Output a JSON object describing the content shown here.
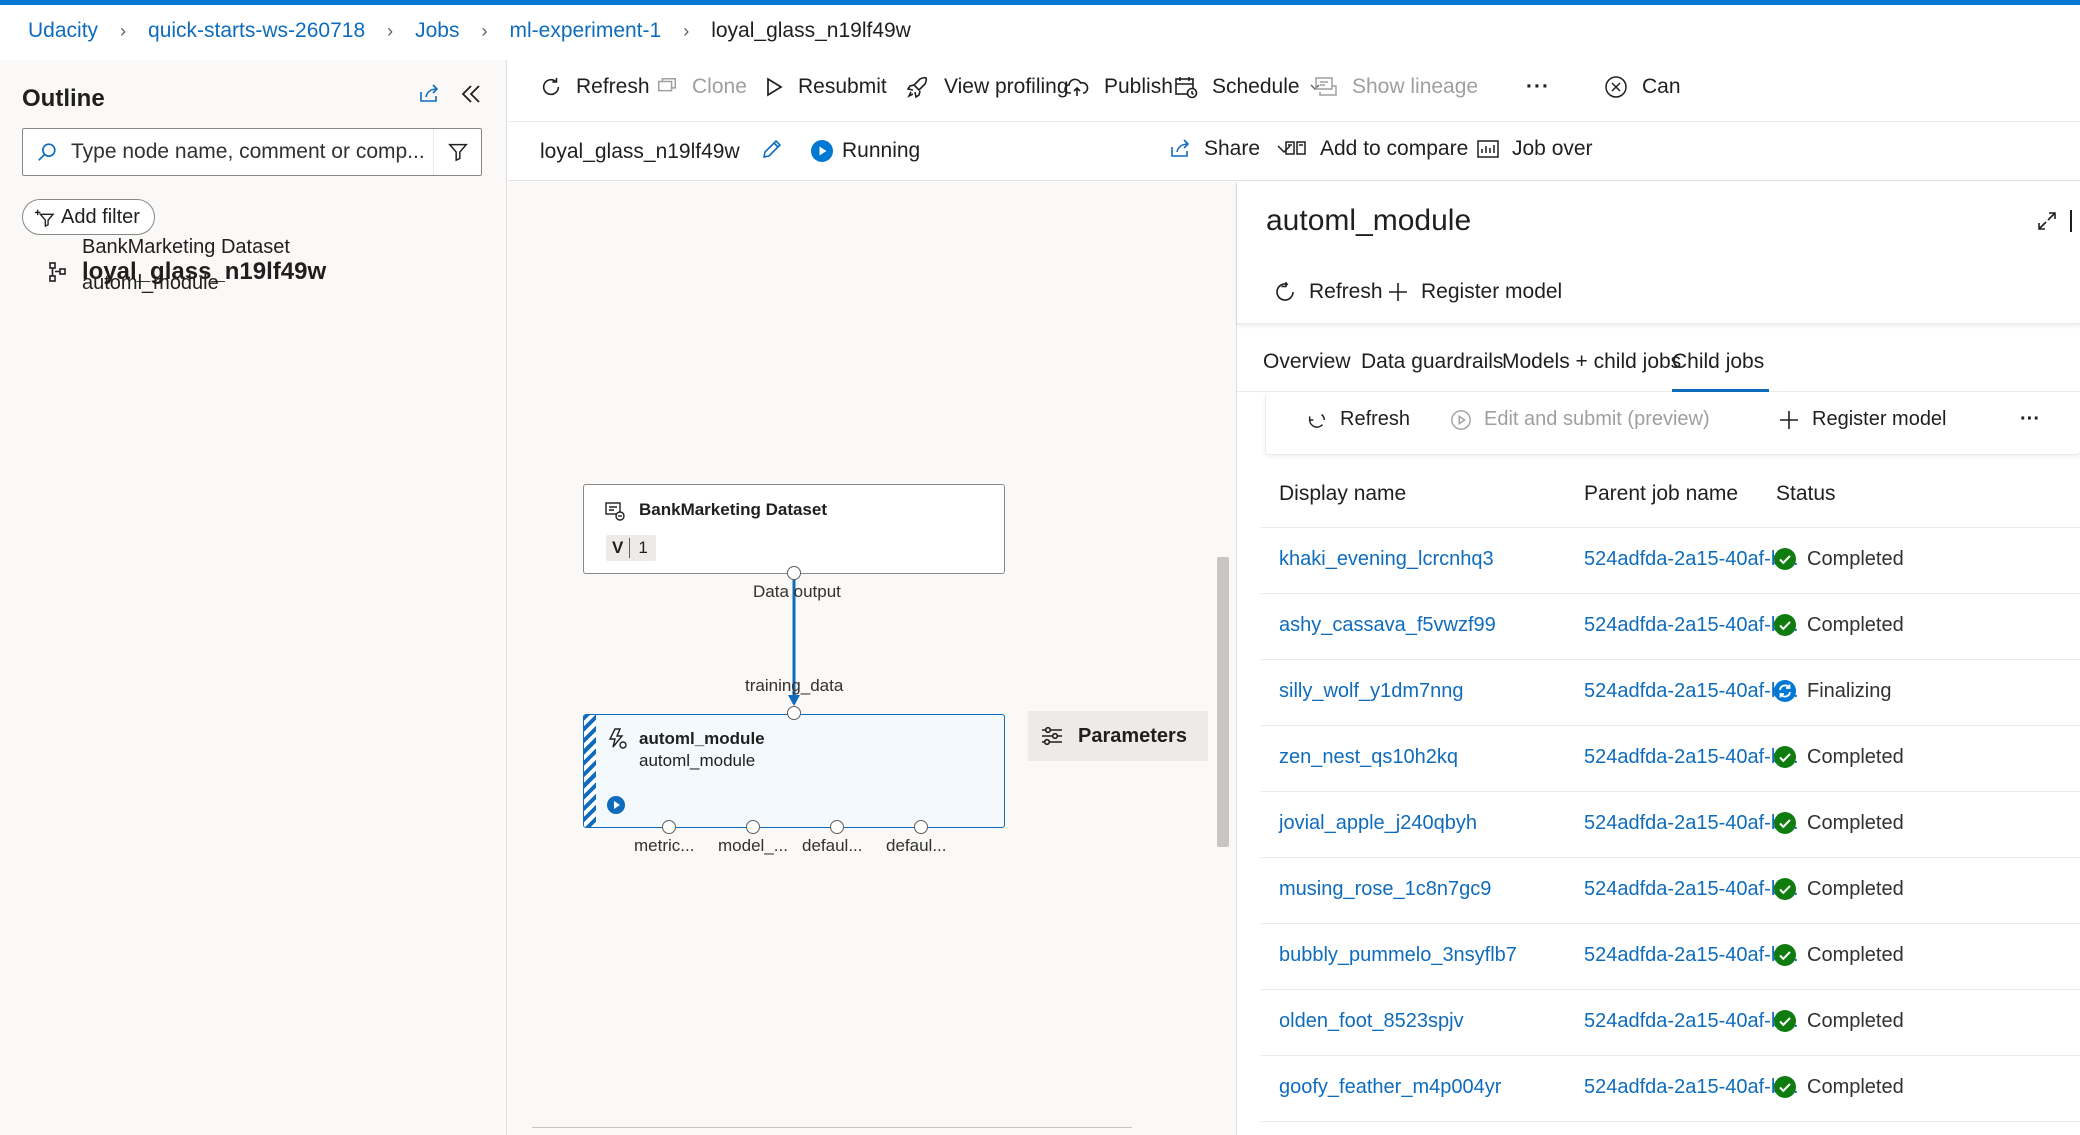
{
  "breadcrumb": {
    "items": [
      "Udacity",
      "quick-starts-ws-260718",
      "Jobs",
      "ml-experiment-1"
    ],
    "current": "loyal_glass_n19lf49w"
  },
  "outline": {
    "title": "Outline",
    "search_placeholder": "Type node name, comment or comp...",
    "add_filter": "Add filter",
    "root": "loyal_glass_n19lf49w",
    "items": [
      "BankMarketing Dataset",
      "automl_module"
    ]
  },
  "toolbar": {
    "refresh": "Refresh",
    "clone": "Clone",
    "resubmit": "Resubmit",
    "view_profiling": "View profiling",
    "publish": "Publish",
    "schedule": "Schedule",
    "show_lineage": "Show lineage",
    "more": "···",
    "cancel": "Can"
  },
  "job": {
    "name": "loyal_glass_n19lf49w",
    "status": "Running",
    "share": "Share",
    "add_to_compare": "Add to compare",
    "job_overview": "Job over"
  },
  "canvas": {
    "dataset_node": {
      "title": "BankMarketing Dataset",
      "version_label": "V",
      "version": "1",
      "output_port": "Data output"
    },
    "module_node": {
      "title": "automl_module",
      "subtitle": "automl_module",
      "input_port": "training_data",
      "output_ports": [
        "metric...",
        "model_...",
        "defaul...",
        "defaul..."
      ]
    },
    "parameters": "Parameters"
  },
  "panel": {
    "title": "automl_module",
    "refresh": "Refresh",
    "register_model": "Register model",
    "tabs": [
      "Overview",
      "Data guardrails",
      "Models + child jobs",
      "Child jobs"
    ],
    "active_tab": "Child jobs",
    "child_toolbar": {
      "refresh": "Refresh",
      "edit_submit": "Edit and submit (preview)",
      "register_model": "Register model",
      "more": "···"
    },
    "table": {
      "headers": [
        "Display name",
        "Parent job name",
        "Status"
      ],
      "rows": [
        {
          "name": "khaki_evening_lcrcnhq3",
          "parent": "524adfda-2a15-40af-b...",
          "status": "Completed"
        },
        {
          "name": "ashy_cassava_f5vwzf99",
          "parent": "524adfda-2a15-40af-b...",
          "status": "Completed"
        },
        {
          "name": "silly_wolf_y1dm7nng",
          "parent": "524adfda-2a15-40af-b...",
          "status": "Finalizing"
        },
        {
          "name": "zen_nest_qs10h2kq",
          "parent": "524adfda-2a15-40af-b...",
          "status": "Completed"
        },
        {
          "name": "jovial_apple_j240qbyh",
          "parent": "524adfda-2a15-40af-b...",
          "status": "Completed"
        },
        {
          "name": "musing_rose_1c8n7gc9",
          "parent": "524adfda-2a15-40af-b...",
          "status": "Completed"
        },
        {
          "name": "bubbly_pummelo_3nsyflb7",
          "parent": "524adfda-2a15-40af-b...",
          "status": "Completed"
        },
        {
          "name": "olden_foot_8523spjv",
          "parent": "524adfda-2a15-40af-b...",
          "status": "Completed"
        },
        {
          "name": "goofy_feather_m4p004yr",
          "parent": "524adfda-2a15-40af-b...",
          "status": "Completed"
        }
      ]
    }
  },
  "colors": {
    "accent": "#0f6cbd",
    "success": "#107c10",
    "running": "#0078d4"
  }
}
